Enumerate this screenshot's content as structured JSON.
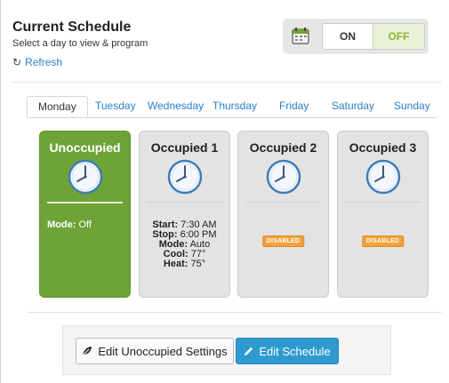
{
  "header": {
    "title": "Current Schedule",
    "subtitle": "Select a day to view & program",
    "refresh_label": "Refresh",
    "refresh_icon": "refresh-icon"
  },
  "toggle": {
    "calendar_icon": "calendar-icon",
    "on_label": "ON",
    "off_label": "OFF",
    "selected": "OFF",
    "accent": "#8bb535"
  },
  "tabs": [
    {
      "label": "Monday",
      "active": true
    },
    {
      "label": "Tuesday",
      "active": false
    },
    {
      "label": "Wednesday",
      "active": false
    },
    {
      "label": "Thursday",
      "active": false
    },
    {
      "label": "Friday",
      "active": false
    },
    {
      "label": "Saturday",
      "active": false
    },
    {
      "label": "Sunday",
      "active": false
    }
  ],
  "cards": [
    {
      "title": "Unoccupied",
      "icon": "clock-icon",
      "color": "#6ea338",
      "mode_label": "Mode:",
      "mode_value": "Off"
    },
    {
      "title": "Occupied 1",
      "icon": "clock-icon",
      "color": "#e3e3e3",
      "details": [
        {
          "label": "Start:",
          "value": "7:30 AM"
        },
        {
          "label": "Stop:",
          "value": "6:00 PM"
        },
        {
          "label": "Mode:",
          "value": "Auto"
        },
        {
          "label": "Cool:",
          "value": "77°"
        },
        {
          "label": "Heat:",
          "value": "75°"
        }
      ]
    },
    {
      "title": "Occupied 2",
      "icon": "clock-icon",
      "color": "#e3e3e3",
      "badge": "DISABLED"
    },
    {
      "title": "Occupied 3",
      "icon": "clock-icon",
      "color": "#e3e3e3",
      "badge": "DISABLED"
    }
  ],
  "actions": {
    "edit_unoccupied_label": "Edit Unoccupied Settings",
    "edit_unoccupied_icon": "leaf-icon",
    "edit_schedule_label": "Edit Schedule",
    "edit_schedule_icon": "pencil-icon",
    "primary_color": "#2f9ad0"
  }
}
